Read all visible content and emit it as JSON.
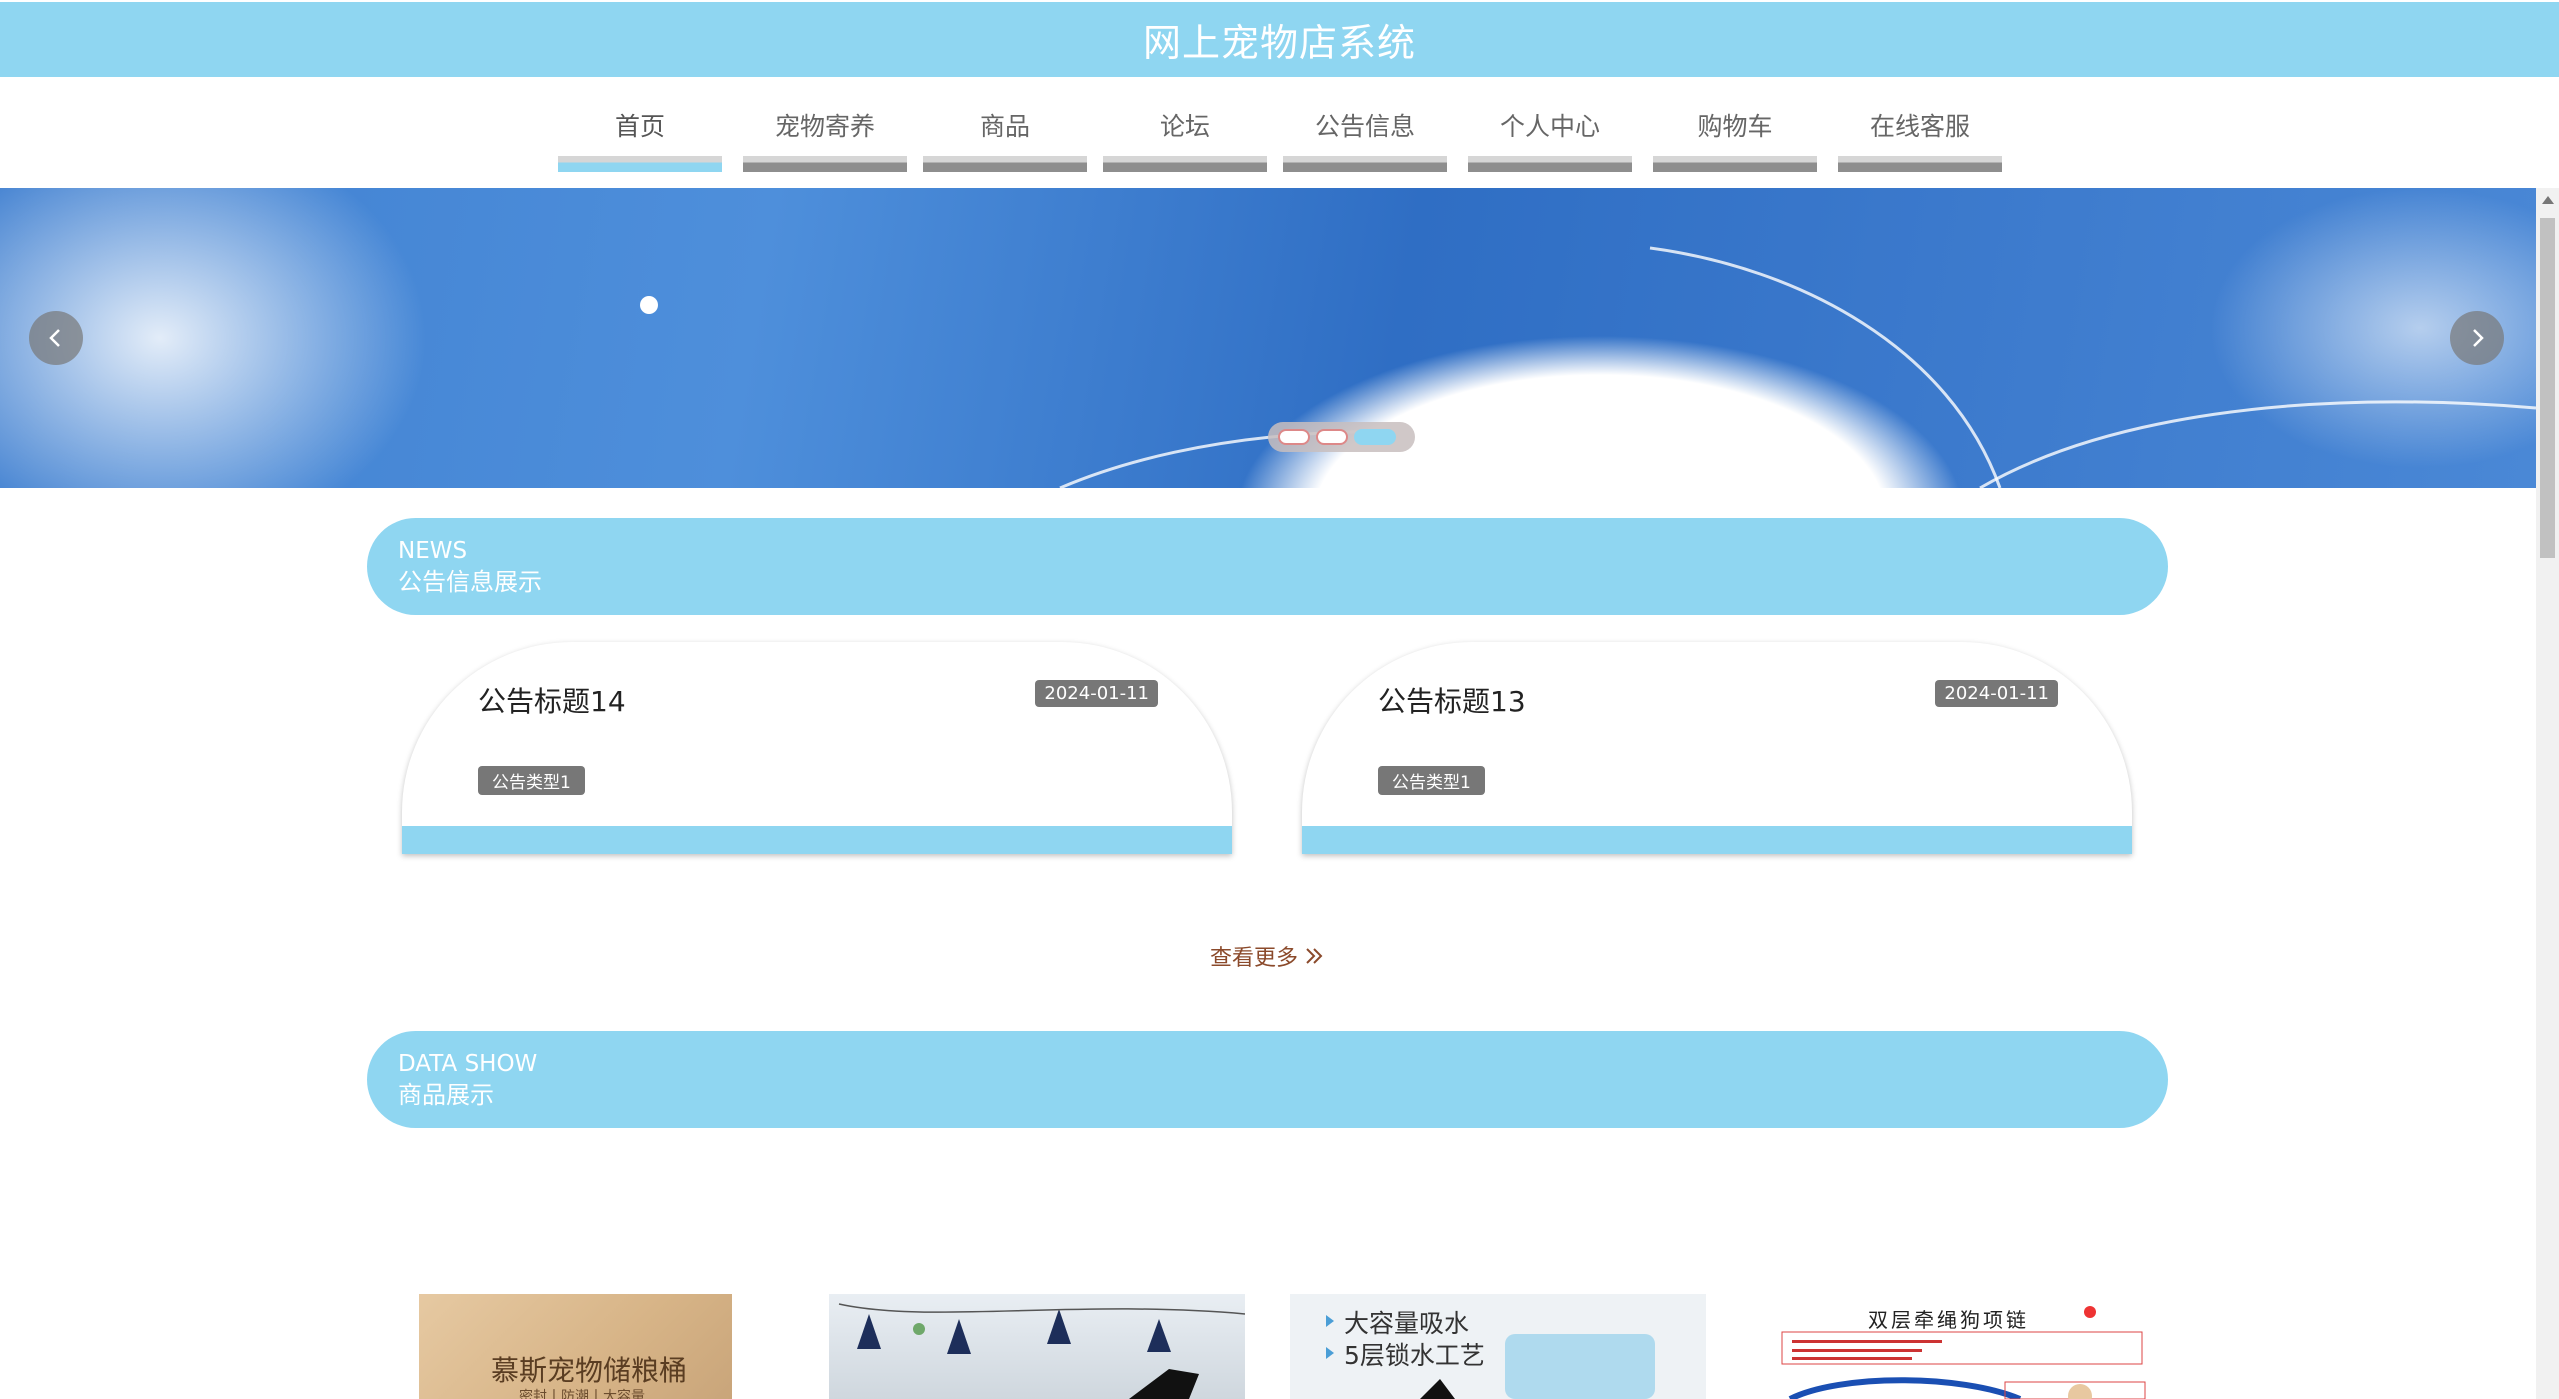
{
  "header": {
    "title": "网上宠物店系统"
  },
  "nav": {
    "items": [
      {
        "label": "首页",
        "active": true
      },
      {
        "label": "宠物寄养",
        "active": false
      },
      {
        "label": "商品",
        "active": false
      },
      {
        "label": "论坛",
        "active": false
      },
      {
        "label": "公告信息",
        "active": false
      },
      {
        "label": "个人中心",
        "active": false
      },
      {
        "label": "购物车",
        "active": false
      },
      {
        "label": "在线客服",
        "active": false
      }
    ]
  },
  "banner": {
    "slide_count": 3,
    "active_slide": 3
  },
  "news": {
    "en": "NEWS",
    "cn": "公告信息展示",
    "items": [
      {
        "title": "公告标题14",
        "date": "2024-01-11",
        "type": "公告类型1"
      },
      {
        "title": "公告标题13",
        "date": "2024-01-11",
        "type": "公告类型1"
      }
    ],
    "more": "查看更多"
  },
  "products": {
    "en": "DATA SHOW",
    "cn": "商品展示",
    "items": [
      {
        "text": "慕斯宠物储粮桶",
        "sub": "密封丨防潮丨大容量"
      },
      {
        "text": ""
      },
      {
        "lines": [
          "大容量吸水",
          "5层锁水工艺"
        ]
      },
      {
        "text": "双层牵绳狗项链"
      }
    ]
  },
  "colors": {
    "accent": "#8fd6f1",
    "nav_bar": "#8e8e8e",
    "more_link": "#8b4a2b"
  }
}
